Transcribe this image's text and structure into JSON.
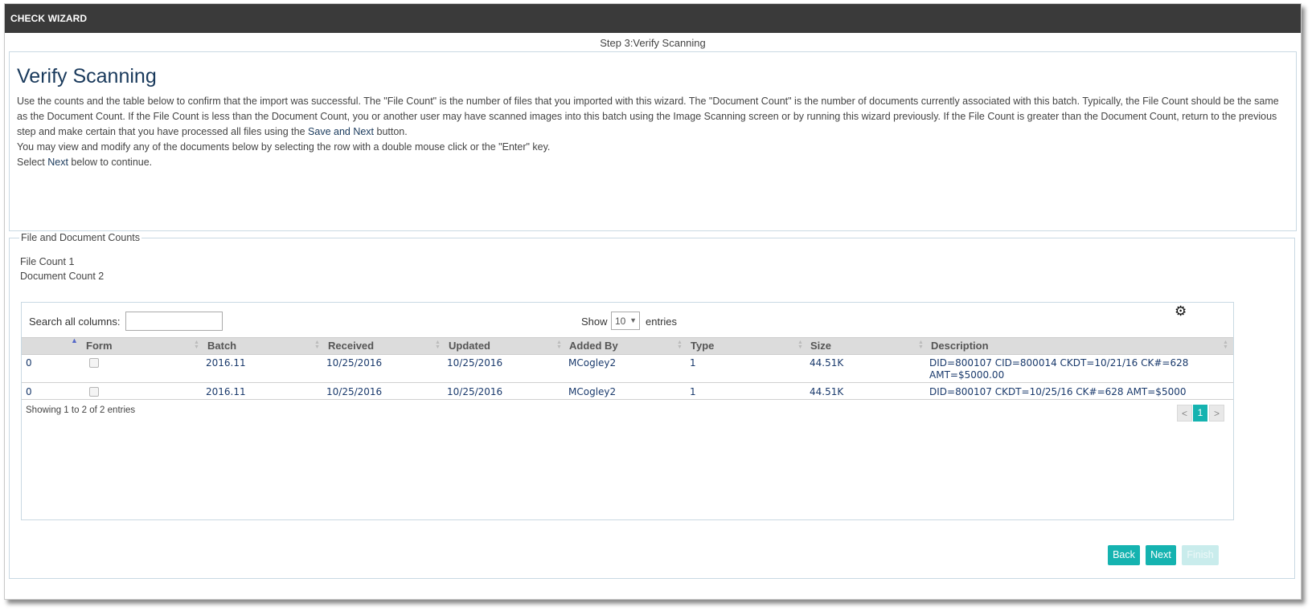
{
  "window": {
    "title": "CHECK WIZARD"
  },
  "step_label": "Step 3:Verify Scanning",
  "verify": {
    "heading": "Verify Scanning",
    "para1_a": "Use the counts and the table below to confirm that the import was successful. The \"File Count\" is the number of files that you imported with this wizard. The \"Document Count\" is the number of documents currently associated with this batch. Typically, the File Count should be the same as the Document Count. If the File Count is less than the Document Count, you or another user may have scanned images into this batch using the Image Scanning screen or by running this wizard previously. If the File Count is greater than the Document Count, return to the previous step and make certain that you have processed all files using the ",
    "para1_bold": "Save and Next",
    "para1_b": " button.",
    "para2": "You may view and modify any of the documents below by selecting the row with a double mouse click or the \"Enter\" key.",
    "para3_a": "Select ",
    "para3_bold": "Next",
    "para3_b": " below to continue."
  },
  "counts": {
    "legend": "File and Document Counts",
    "file_count": "File Count 1",
    "document_count": "Document Count 2"
  },
  "table": {
    "search_label": "Search all columns:",
    "search_value": "",
    "show_label": "Show",
    "entries_value": "10",
    "entries_label": "entries",
    "settings_icon": "gear-icon",
    "columns": [
      "Form",
      "Batch",
      "Received",
      "Updated",
      "Added By",
      "Type",
      "Size",
      "Description"
    ],
    "rows": [
      {
        "id": "0",
        "checked": false,
        "batch": "2016.11",
        "received": "10/25/2016",
        "updated": "10/25/2016",
        "added_by": "MCogley2",
        "type": "1",
        "size": "44.51K",
        "description_line1": "DID=800107 CID=800014 CKDT=10/21/16 CK#=628",
        "description_line2": "AMT=$5000.00"
      },
      {
        "id": "0",
        "checked": false,
        "batch": "2016.11",
        "received": "10/25/2016",
        "updated": "10/25/2016",
        "added_by": "MCogley2",
        "type": "1",
        "size": "44.51K",
        "description_line1": "DID=800107 CKDT=10/25/16 CK#=628 AMT=$5000",
        "description_line2": ""
      }
    ],
    "info": "Showing 1 to 2 of 2 entries",
    "pager": {
      "prev": "<",
      "current": "1",
      "next": ">"
    }
  },
  "buttons": {
    "back": "Back",
    "next": "Next",
    "finish": "Finish"
  },
  "colors": {
    "titlebar": "#3a3a3a",
    "accent": "#15b3b0",
    "heading": "#1a3a5c",
    "link_text": "#1a3a6c"
  }
}
